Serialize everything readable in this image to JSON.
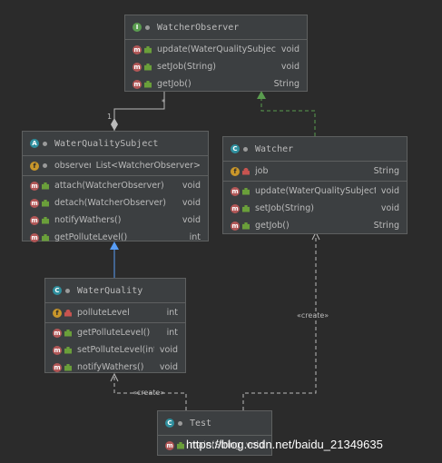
{
  "watermark": "https://blog.csdn.net/baidu_21349635",
  "relations": {
    "observer_mult_one": "1",
    "observer_mult_many": "*",
    "create_label_1": "«create»",
    "create_label_2": "«create»"
  },
  "watcher_observer": {
    "name": "WatcherObserver",
    "icon": "I",
    "methods": [
      {
        "name": "update(WaterQualitySubject)",
        "type": "void"
      },
      {
        "name": "setJob(String)",
        "type": "void"
      },
      {
        "name": "getJob()",
        "type": "String"
      }
    ]
  },
  "water_quality_subject": {
    "name": "WaterQualitySubject",
    "icon": "A",
    "fields": [
      {
        "name": "observers",
        "type": "List<WatcherObserver>"
      }
    ],
    "methods": [
      {
        "name": "attach(WatcherObserver)",
        "type": "void"
      },
      {
        "name": "detach(WatcherObserver)",
        "type": "void"
      },
      {
        "name": "notifyWathers()",
        "type": "void"
      },
      {
        "name": "getPolluteLevel()",
        "type": "int"
      }
    ]
  },
  "watcher": {
    "name": "Watcher",
    "icon": "C",
    "fields": [
      {
        "name": "job",
        "type": "String"
      }
    ],
    "methods": [
      {
        "name": "update(WaterQualitySubject)",
        "type": "void"
      },
      {
        "name": "setJob(String)",
        "type": "void"
      },
      {
        "name": "getJob()",
        "type": "String"
      }
    ]
  },
  "water_quality": {
    "name": "WaterQuality",
    "icon": "C",
    "fields": [
      {
        "name": "polluteLevel",
        "type": "int"
      }
    ],
    "methods": [
      {
        "name": "getPolluteLevel()",
        "type": "int"
      },
      {
        "name": "setPolluteLevel(int)",
        "type": "void"
      },
      {
        "name": "notifyWathers()",
        "type": "void"
      }
    ]
  },
  "test": {
    "name": "Test",
    "icon": "C",
    "methods": [
      {
        "name": "main(String[])",
        "type": "void"
      }
    ]
  },
  "colors": {
    "background": "#2b2b2b",
    "box": "#3c3f41",
    "border": "#5e6060",
    "text": "#bbbbbb",
    "realization": "#5a9c4f",
    "generalization": "#589df6",
    "dependency": "#bbbbbb"
  }
}
